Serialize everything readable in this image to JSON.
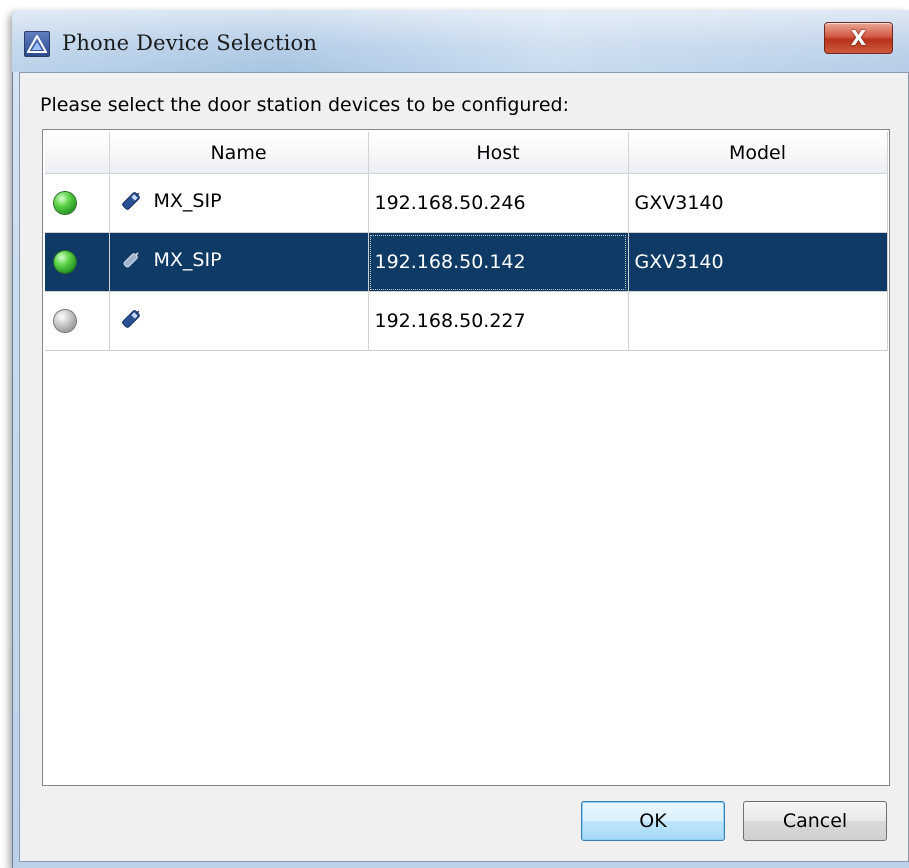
{
  "window": {
    "title": "Phone Device Selection",
    "close_label": "X"
  },
  "prompt": "Please select the door station devices to be configured:",
  "table": {
    "columns": [
      "",
      "Name",
      "Host",
      "Model"
    ],
    "rows": [
      {
        "status": "online",
        "status_color": "#3fbf34",
        "icon": "phone-icon",
        "name": "MX_SIP",
        "host": "192.168.50.246",
        "model": "GXV3140",
        "selected": false
      },
      {
        "status": "online",
        "status_color": "#3fbf34",
        "icon": "phone-icon",
        "name": "MX_SIP",
        "host": "192.168.50.142",
        "model": "GXV3140",
        "selected": true
      },
      {
        "status": "offline",
        "status_color": "#a0a0a0",
        "icon": "phone-icon",
        "name": "",
        "host": "192.168.50.227",
        "model": "",
        "selected": false
      }
    ]
  },
  "buttons": {
    "ok": "OK",
    "cancel": "Cancel"
  },
  "colors": {
    "selection": "#0f3a66",
    "close_button": "#c9452c"
  }
}
